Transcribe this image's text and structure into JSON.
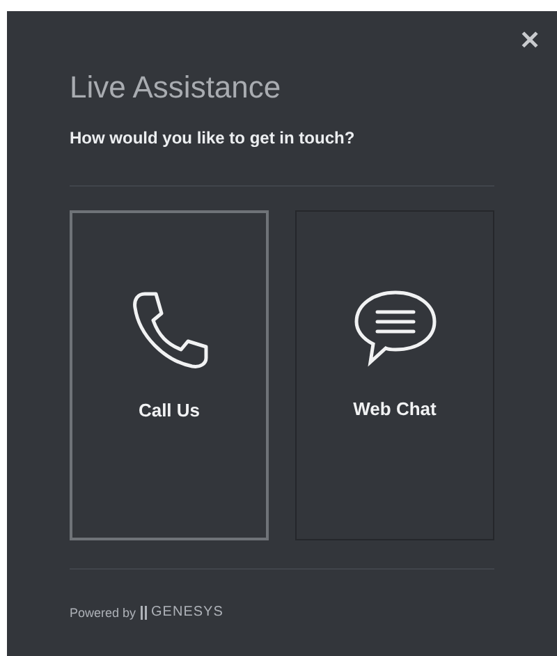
{
  "dialog": {
    "close": "✕",
    "title": "Live Assistance",
    "prompt": "How would you like to get in touch?"
  },
  "options": [
    {
      "kind": "phone",
      "label": "Call Us",
      "selected": true
    },
    {
      "kind": "chat",
      "label": "Web Chat",
      "selected": false
    }
  ],
  "footer": {
    "powered_by": "Powered by",
    "brand": "GENESYS"
  }
}
